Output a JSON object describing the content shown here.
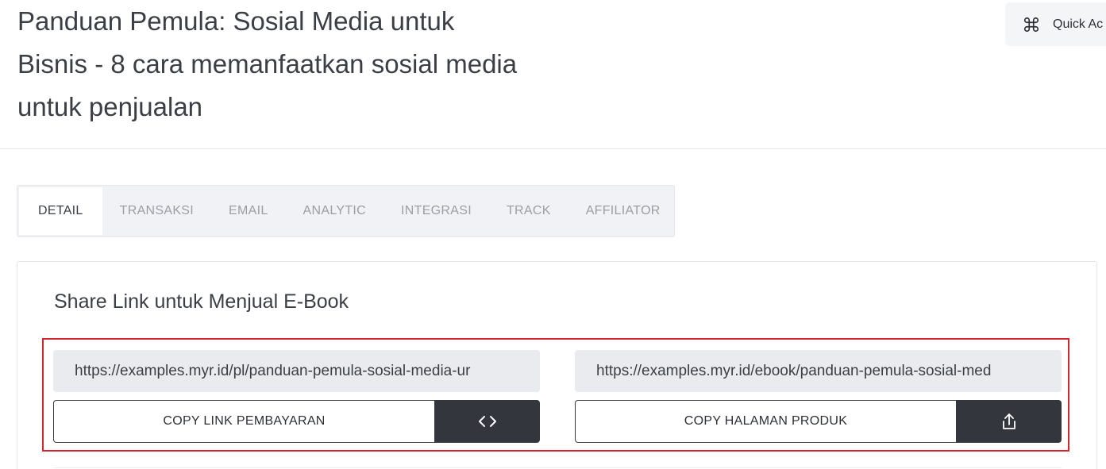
{
  "page": {
    "title": "Panduan Pemula: Sosial Media untuk Bisnis - 8 cara memanfaatkan sosial media untuk penjualan"
  },
  "quick_access": {
    "label": "Quick Ac",
    "icon": "command-icon"
  },
  "tabs": [
    {
      "label": "DETAIL",
      "active": true
    },
    {
      "label": "TRANSAKSI",
      "active": false
    },
    {
      "label": "EMAIL",
      "active": false
    },
    {
      "label": "ANALYTIC",
      "active": false
    },
    {
      "label": "INTEGRASI",
      "active": false
    },
    {
      "label": "TRACK",
      "active": false
    },
    {
      "label": "AFFILIATOR",
      "active": false
    }
  ],
  "share": {
    "title": "Share Link untuk Menjual E-Book",
    "payment": {
      "url": "https://examples.myr.id/pl/panduan-pemula-sosial-media-ur",
      "button_label": "COPY LINK PEMBAYARAN",
      "icon": "code-icon"
    },
    "product": {
      "url": "https://examples.myr.id/ebook/panduan-pemula-sosial-med",
      "button_label": "COPY HALAMAN PRODUK",
      "icon": "share-icon"
    }
  },
  "colors": {
    "highlight_border": "#d6232e",
    "dark_button": "#33373d",
    "field_bg": "#e9ebee"
  }
}
